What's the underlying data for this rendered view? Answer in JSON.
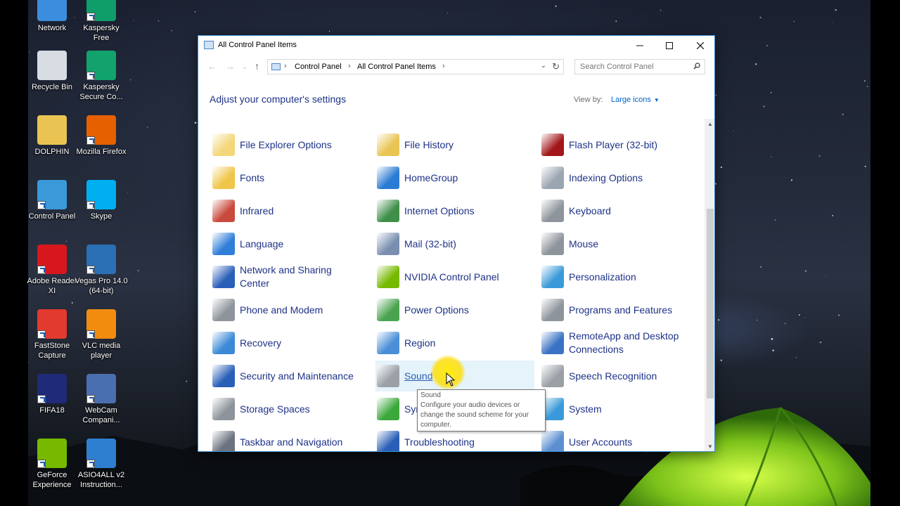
{
  "desktop": {
    "icons": [
      {
        "label": "Network",
        "icon": "network-icon",
        "color": "#3b8ede"
      },
      {
        "label": "Kaspersky Free",
        "icon": "kaspersky-free-icon",
        "color": "#0f9d6a"
      },
      {
        "label": "Recycle Bin",
        "icon": "recycle-bin-icon",
        "color": "#d8dde4"
      },
      {
        "label": "Kaspersky Secure Co...",
        "icon": "kaspersky-secure-connection-icon",
        "color": "#12a36c"
      },
      {
        "label": "DOLPHIN",
        "icon": "user-folder-icon",
        "color": "#e9c453"
      },
      {
        "label": "Mozilla Firefox",
        "icon": "firefox-icon",
        "color": "#e66000"
      },
      {
        "label": "Control Panel",
        "icon": "control-panel-icon",
        "color": "#3a9ad9"
      },
      {
        "label": "Skype",
        "icon": "skype-icon",
        "color": "#00aff0"
      },
      {
        "label": "Adobe Reader XI",
        "icon": "adobe-reader-icon",
        "color": "#d7171d"
      },
      {
        "label": "Vegas Pro 14.0 (64-bit)",
        "icon": "vegas-pro-icon",
        "color": "#2b6fb5"
      },
      {
        "label": "FastStone Capture",
        "icon": "faststone-capture-icon",
        "color": "#e23a2e"
      },
      {
        "label": "VLC media player",
        "icon": "vlc-icon",
        "color": "#f28c0f"
      },
      {
        "label": "FIFA18",
        "icon": "fifa18-icon",
        "color": "#1f2a78"
      },
      {
        "label": "WebCam Compani...",
        "icon": "webcam-icon",
        "color": "#4a6fb0"
      },
      {
        "label": "GeForce Experience",
        "icon": "geforce-experience-icon",
        "color": "#76b900"
      },
      {
        "label": "ASIO4ALL v2 Instruction...",
        "icon": "pdf-document-icon",
        "color": "#2f7fd0"
      }
    ]
  },
  "window": {
    "title": "All Control Panel Items",
    "address": {
      "crumbs": [
        "Control Panel",
        "All Control Panel Items"
      ]
    },
    "search": {
      "placeholder": "Search Control Panel"
    },
    "heading": "Adjust your computer's settings",
    "view_by": {
      "label": "View by:",
      "value": "Large icons"
    }
  },
  "items": [
    {
      "label": "File Explorer Options",
      "icon": "file-explorer-options-icon",
      "color": "#f3d77a"
    },
    {
      "label": "File History",
      "icon": "file-history-icon",
      "color": "#e9c453"
    },
    {
      "label": "Flash Player (32-bit)",
      "icon": "flash-player-icon",
      "color": "#a3171a"
    },
    {
      "label": "Fonts",
      "icon": "fonts-icon",
      "color": "#f0c64a"
    },
    {
      "label": "HomeGroup",
      "icon": "homegroup-icon",
      "color": "#2a7bd3"
    },
    {
      "label": "Indexing Options",
      "icon": "indexing-options-icon",
      "color": "#9aa5b1"
    },
    {
      "label": "Infrared",
      "icon": "infrared-icon",
      "color": "#c94a3d"
    },
    {
      "label": "Internet Options",
      "icon": "internet-options-icon",
      "color": "#3f8f4a"
    },
    {
      "label": "Keyboard",
      "icon": "keyboard-icon",
      "color": "#8d949b"
    },
    {
      "label": "Language",
      "icon": "language-icon",
      "color": "#2f7ed8"
    },
    {
      "label": "Mail (32-bit)",
      "icon": "mail-icon",
      "color": "#7a8fb0"
    },
    {
      "label": "Mouse",
      "icon": "mouse-icon",
      "color": "#8d949b"
    },
    {
      "label": "Network and Sharing Center",
      "icon": "network-sharing-icon",
      "color": "#2a5fb8"
    },
    {
      "label": "NVIDIA Control Panel",
      "icon": "nvidia-icon",
      "color": "#76b900"
    },
    {
      "label": "Personalization",
      "icon": "personalization-icon",
      "color": "#3a9ad9"
    },
    {
      "label": "Phone and Modem",
      "icon": "phone-modem-icon",
      "color": "#8d949b"
    },
    {
      "label": "Power Options",
      "icon": "power-options-icon",
      "color": "#4aa34f"
    },
    {
      "label": "Programs and Features",
      "icon": "programs-features-icon",
      "color": "#8d949b"
    },
    {
      "label": "Recovery",
      "icon": "recovery-icon",
      "color": "#3c8ad6"
    },
    {
      "label": "Region",
      "icon": "region-icon",
      "color": "#4a8ed8"
    },
    {
      "label": "RemoteApp and Desktop Connections",
      "icon": "remoteapp-icon",
      "color": "#3a72c4"
    },
    {
      "label": "Security and Maintenance",
      "icon": "security-maintenance-icon",
      "color": "#2a5fb8"
    },
    {
      "label": "Sound",
      "icon": "sound-icon",
      "color": "#9aa0a6"
    },
    {
      "label": "Speech Recognition",
      "icon": "speech-recognition-icon",
      "color": "#9aa0a6"
    },
    {
      "label": "Storage Spaces",
      "icon": "storage-spaces-icon",
      "color": "#8d949b"
    },
    {
      "label": "Sync Center",
      "icon": "sync-center-icon",
      "color": "#3ba83c"
    },
    {
      "label": "System",
      "icon": "system-icon",
      "color": "#3a9ad9"
    },
    {
      "label": "Taskbar and Navigation",
      "icon": "taskbar-navigation-icon",
      "color": "#6b7280"
    },
    {
      "label": "Troubleshooting",
      "icon": "troubleshooting-icon",
      "color": "#2a5fb8"
    },
    {
      "label": "User Accounts",
      "icon": "user-accounts-icon",
      "color": "#5b8fd0"
    }
  ],
  "tooltip": {
    "title": "Sound",
    "body": "Configure your audio devices or change the sound scheme for your computer."
  },
  "colors": {
    "link": "#1e3287",
    "accent": "#0066cc",
    "window_border": "#3f8fd8",
    "cursor_highlight": "#ffe600"
  }
}
